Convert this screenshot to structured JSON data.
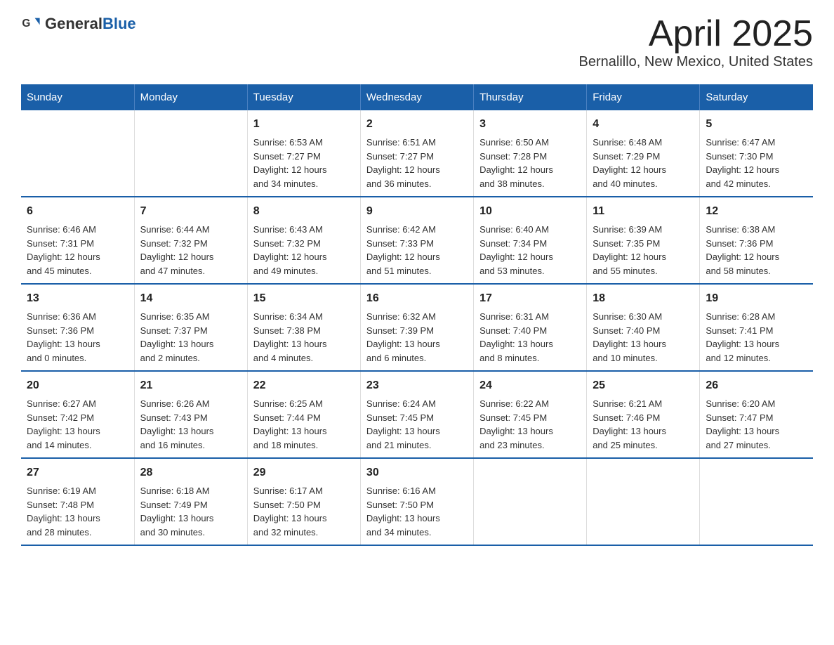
{
  "header": {
    "logo_general": "General",
    "logo_blue": "Blue",
    "title": "April 2025",
    "subtitle": "Bernalillo, New Mexico, United States"
  },
  "days_of_week": [
    "Sunday",
    "Monday",
    "Tuesday",
    "Wednesday",
    "Thursday",
    "Friday",
    "Saturday"
  ],
  "weeks": [
    {
      "days": [
        {
          "num": "",
          "info": ""
        },
        {
          "num": "",
          "info": ""
        },
        {
          "num": "1",
          "info": "Sunrise: 6:53 AM\nSunset: 7:27 PM\nDaylight: 12 hours\nand 34 minutes."
        },
        {
          "num": "2",
          "info": "Sunrise: 6:51 AM\nSunset: 7:27 PM\nDaylight: 12 hours\nand 36 minutes."
        },
        {
          "num": "3",
          "info": "Sunrise: 6:50 AM\nSunset: 7:28 PM\nDaylight: 12 hours\nand 38 minutes."
        },
        {
          "num": "4",
          "info": "Sunrise: 6:48 AM\nSunset: 7:29 PM\nDaylight: 12 hours\nand 40 minutes."
        },
        {
          "num": "5",
          "info": "Sunrise: 6:47 AM\nSunset: 7:30 PM\nDaylight: 12 hours\nand 42 minutes."
        }
      ]
    },
    {
      "days": [
        {
          "num": "6",
          "info": "Sunrise: 6:46 AM\nSunset: 7:31 PM\nDaylight: 12 hours\nand 45 minutes."
        },
        {
          "num": "7",
          "info": "Sunrise: 6:44 AM\nSunset: 7:32 PM\nDaylight: 12 hours\nand 47 minutes."
        },
        {
          "num": "8",
          "info": "Sunrise: 6:43 AM\nSunset: 7:32 PM\nDaylight: 12 hours\nand 49 minutes."
        },
        {
          "num": "9",
          "info": "Sunrise: 6:42 AM\nSunset: 7:33 PM\nDaylight: 12 hours\nand 51 minutes."
        },
        {
          "num": "10",
          "info": "Sunrise: 6:40 AM\nSunset: 7:34 PM\nDaylight: 12 hours\nand 53 minutes."
        },
        {
          "num": "11",
          "info": "Sunrise: 6:39 AM\nSunset: 7:35 PM\nDaylight: 12 hours\nand 55 minutes."
        },
        {
          "num": "12",
          "info": "Sunrise: 6:38 AM\nSunset: 7:36 PM\nDaylight: 12 hours\nand 58 minutes."
        }
      ]
    },
    {
      "days": [
        {
          "num": "13",
          "info": "Sunrise: 6:36 AM\nSunset: 7:36 PM\nDaylight: 13 hours\nand 0 minutes."
        },
        {
          "num": "14",
          "info": "Sunrise: 6:35 AM\nSunset: 7:37 PM\nDaylight: 13 hours\nand 2 minutes."
        },
        {
          "num": "15",
          "info": "Sunrise: 6:34 AM\nSunset: 7:38 PM\nDaylight: 13 hours\nand 4 minutes."
        },
        {
          "num": "16",
          "info": "Sunrise: 6:32 AM\nSunset: 7:39 PM\nDaylight: 13 hours\nand 6 minutes."
        },
        {
          "num": "17",
          "info": "Sunrise: 6:31 AM\nSunset: 7:40 PM\nDaylight: 13 hours\nand 8 minutes."
        },
        {
          "num": "18",
          "info": "Sunrise: 6:30 AM\nSunset: 7:40 PM\nDaylight: 13 hours\nand 10 minutes."
        },
        {
          "num": "19",
          "info": "Sunrise: 6:28 AM\nSunset: 7:41 PM\nDaylight: 13 hours\nand 12 minutes."
        }
      ]
    },
    {
      "days": [
        {
          "num": "20",
          "info": "Sunrise: 6:27 AM\nSunset: 7:42 PM\nDaylight: 13 hours\nand 14 minutes."
        },
        {
          "num": "21",
          "info": "Sunrise: 6:26 AM\nSunset: 7:43 PM\nDaylight: 13 hours\nand 16 minutes."
        },
        {
          "num": "22",
          "info": "Sunrise: 6:25 AM\nSunset: 7:44 PM\nDaylight: 13 hours\nand 18 minutes."
        },
        {
          "num": "23",
          "info": "Sunrise: 6:24 AM\nSunset: 7:45 PM\nDaylight: 13 hours\nand 21 minutes."
        },
        {
          "num": "24",
          "info": "Sunrise: 6:22 AM\nSunset: 7:45 PM\nDaylight: 13 hours\nand 23 minutes."
        },
        {
          "num": "25",
          "info": "Sunrise: 6:21 AM\nSunset: 7:46 PM\nDaylight: 13 hours\nand 25 minutes."
        },
        {
          "num": "26",
          "info": "Sunrise: 6:20 AM\nSunset: 7:47 PM\nDaylight: 13 hours\nand 27 minutes."
        }
      ]
    },
    {
      "days": [
        {
          "num": "27",
          "info": "Sunrise: 6:19 AM\nSunset: 7:48 PM\nDaylight: 13 hours\nand 28 minutes."
        },
        {
          "num": "28",
          "info": "Sunrise: 6:18 AM\nSunset: 7:49 PM\nDaylight: 13 hours\nand 30 minutes."
        },
        {
          "num": "29",
          "info": "Sunrise: 6:17 AM\nSunset: 7:50 PM\nDaylight: 13 hours\nand 32 minutes."
        },
        {
          "num": "30",
          "info": "Sunrise: 6:16 AM\nSunset: 7:50 PM\nDaylight: 13 hours\nand 34 minutes."
        },
        {
          "num": "",
          "info": ""
        },
        {
          "num": "",
          "info": ""
        },
        {
          "num": "",
          "info": ""
        }
      ]
    }
  ]
}
